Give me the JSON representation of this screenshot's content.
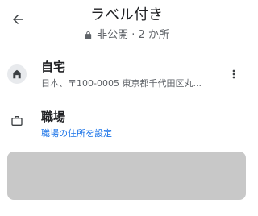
{
  "header": {
    "back_icon": "arrow-left-icon",
    "title": "ラベル付き",
    "subtitle": {
      "lock_icon": "lock-icon",
      "text": "非公開 · 2 か所"
    }
  },
  "items": [
    {
      "icon": "home-icon",
      "name": "自宅",
      "detail": "日本、〒100-0005 東京都千代田区丸...",
      "more_icon": "more-vert-icon"
    },
    {
      "icon": "briefcase-icon",
      "name": "職場",
      "link": "職場の住所を設定",
      "link_color": "#1a73e8"
    }
  ],
  "colors": {
    "text_primary": "#202124",
    "text_secondary": "#5f6368",
    "placeholder": "#c8c8c8"
  }
}
